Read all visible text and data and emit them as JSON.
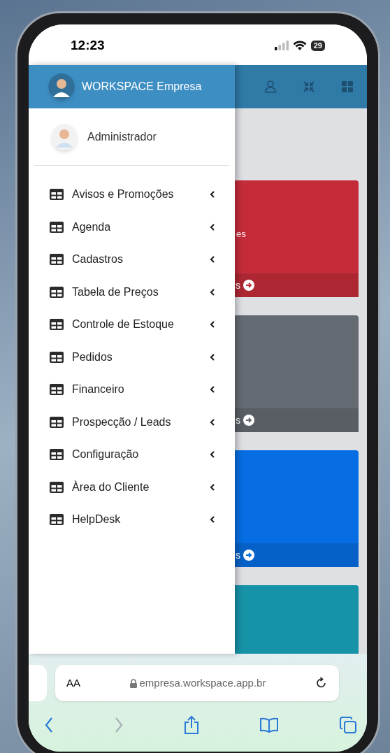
{
  "status_bar": {
    "time": "12:23",
    "battery": "29"
  },
  "drawer": {
    "brand": "WORKSPACE Empresa",
    "user": "Administrador",
    "items": [
      {
        "label": "Avisos e Promoções",
        "expanded": false
      },
      {
        "label": "Agenda",
        "expanded": false
      },
      {
        "label": "Cadastros",
        "expanded": false
      },
      {
        "label": "Tabela de Preços",
        "expanded": false
      },
      {
        "label": "Controle de Estoque",
        "expanded": false
      },
      {
        "label": "Pedidos",
        "expanded": false
      },
      {
        "label": "Financeiro",
        "expanded": false
      },
      {
        "label": "Prospecção / Leads",
        "expanded": false
      },
      {
        "label": "Configuração",
        "expanded": false
      },
      {
        "label": "Àrea do Cliente",
        "expanded": false
      },
      {
        "label": "HelpDesk",
        "expanded": false
      }
    ]
  },
  "cards": [
    {
      "color": "#c52c3a",
      "text": "es",
      "footer": "s"
    },
    {
      "color": "#646b72",
      "footer": "s"
    },
    {
      "color": "#066ee2",
      "footer": "s"
    },
    {
      "color": "#1793a8"
    }
  ],
  "browser": {
    "text_size": "AA",
    "url": "empresa.workspace.app.br"
  }
}
